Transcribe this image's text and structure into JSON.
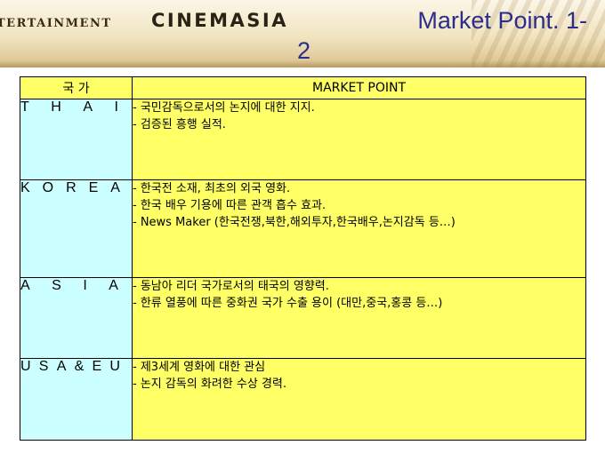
{
  "header": {
    "brand_left": "TERTAINMENT",
    "brand_main": "CINEMASIA",
    "title_line1": "Market Point. 1-",
    "title_line2": "2"
  },
  "table": {
    "headers": [
      "국 가",
      "MARKET POINT"
    ],
    "rows": [
      {
        "country_letters": [
          "T",
          "H",
          "A",
          "I"
        ],
        "points": [
          "- 국민감독으로서의 논지에 대한 지지.",
          "- 검증된 흥행 실적."
        ]
      },
      {
        "country_letters": [
          "K",
          "O",
          "R",
          "E",
          "A"
        ],
        "points": [
          "- 한국전 소재, 최초의 외국 영화.",
          "- 한국 배우 기용에 따른 관객 흡수 효과.",
          "- News Maker (한국전쟁,북한,해외투자,한국배우,논지감독 등…)"
        ]
      },
      {
        "country_letters": [
          "A",
          "S",
          "I",
          "A"
        ],
        "points": [
          "- 동남아 리더 국가로서의 태국의 영향력.",
          "- 한류 열풍에 따른 중화권 국가 수출 용이 (대만,중국,홍콩 등…)"
        ]
      },
      {
        "country_letters": [
          "U",
          "S",
          "A",
          "&",
          "E",
          "U"
        ],
        "points": [
          "- 제3세계 영화에 대한 관심",
          "- 논지 감독의 화려한 수상 경력."
        ]
      }
    ]
  },
  "colors": {
    "title_blue": "#2b2d8c",
    "header_yellow": "#ffff66",
    "country_cyan": "#ccffff"
  }
}
